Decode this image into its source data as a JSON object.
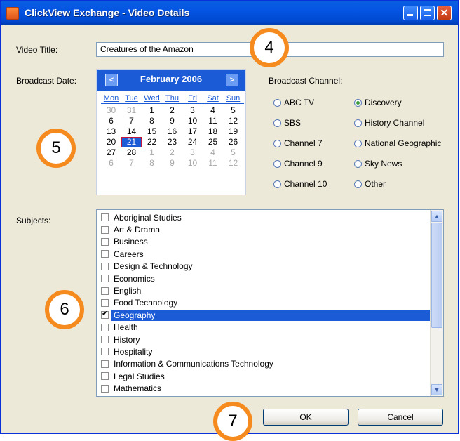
{
  "window": {
    "title": "ClickView Exchange - Video Details",
    "close_glyph": "✕"
  },
  "form": {
    "video_title_label": "Video Title:",
    "video_title_value": "Creatures of the Amazon",
    "broadcast_date_label": "Broadcast Date:",
    "broadcast_channel_label": "Broadcast Channel:",
    "subjects_label": "Subjects:"
  },
  "calendar": {
    "month_label": "February 2006",
    "prev_glyph": "<",
    "next_glyph": ">",
    "days_of_week": [
      "Mon",
      "Tue",
      "Wed",
      "Thu",
      "Fri",
      "Sat",
      "Sun"
    ],
    "selected_day": "21",
    "cells": [
      {
        "d": "30",
        "other": true
      },
      {
        "d": "31",
        "other": true
      },
      {
        "d": "1"
      },
      {
        "d": "2"
      },
      {
        "d": "3"
      },
      {
        "d": "4"
      },
      {
        "d": "5"
      },
      {
        "d": "6"
      },
      {
        "d": "7"
      },
      {
        "d": "8"
      },
      {
        "d": "9"
      },
      {
        "d": "10"
      },
      {
        "d": "11"
      },
      {
        "d": "12"
      },
      {
        "d": "13"
      },
      {
        "d": "14"
      },
      {
        "d": "15"
      },
      {
        "d": "16"
      },
      {
        "d": "17"
      },
      {
        "d": "18"
      },
      {
        "d": "19"
      },
      {
        "d": "20"
      },
      {
        "d": "21",
        "selected": true
      },
      {
        "d": "22"
      },
      {
        "d": "23"
      },
      {
        "d": "24"
      },
      {
        "d": "25"
      },
      {
        "d": "26"
      },
      {
        "d": "27"
      },
      {
        "d": "28"
      },
      {
        "d": "1",
        "other": true
      },
      {
        "d": "2",
        "other": true
      },
      {
        "d": "3",
        "other": true
      },
      {
        "d": "4",
        "other": true
      },
      {
        "d": "5",
        "other": true
      },
      {
        "d": "6",
        "other": true
      },
      {
        "d": "7",
        "other": true
      },
      {
        "d": "8",
        "other": true
      },
      {
        "d": "9",
        "other": true
      },
      {
        "d": "10",
        "other": true
      },
      {
        "d": "11",
        "other": true
      },
      {
        "d": "12",
        "other": true
      }
    ]
  },
  "channels": {
    "left": [
      "ABC TV",
      "SBS",
      "Channel 7",
      "Channel 9",
      "Channel 10"
    ],
    "right": [
      "Discovery",
      "History Channel",
      "National Geographic",
      "Sky News",
      "Other"
    ],
    "selected": "Discovery"
  },
  "subjects": {
    "items": [
      "Aboriginal Studies",
      "Art & Drama",
      "Business",
      "Careers",
      "Design & Technology",
      "Economics",
      "English",
      "Food Technology",
      "Geography",
      "Health",
      "History",
      "Hospitality",
      "Information & Communications Technology",
      "Legal Studies",
      "Mathematics"
    ],
    "selected": "Geography",
    "checked": [
      "Geography"
    ],
    "scroll_up_glyph": "▲",
    "scroll_down_glyph": "▼"
  },
  "buttons": {
    "ok": "OK",
    "cancel": "Cancel"
  },
  "callouts": {
    "c4": "4",
    "c5": "5",
    "c6": "6",
    "c7": "7"
  },
  "colors": {
    "accent": "#1c5bd6",
    "callout": "#f58a1f"
  }
}
